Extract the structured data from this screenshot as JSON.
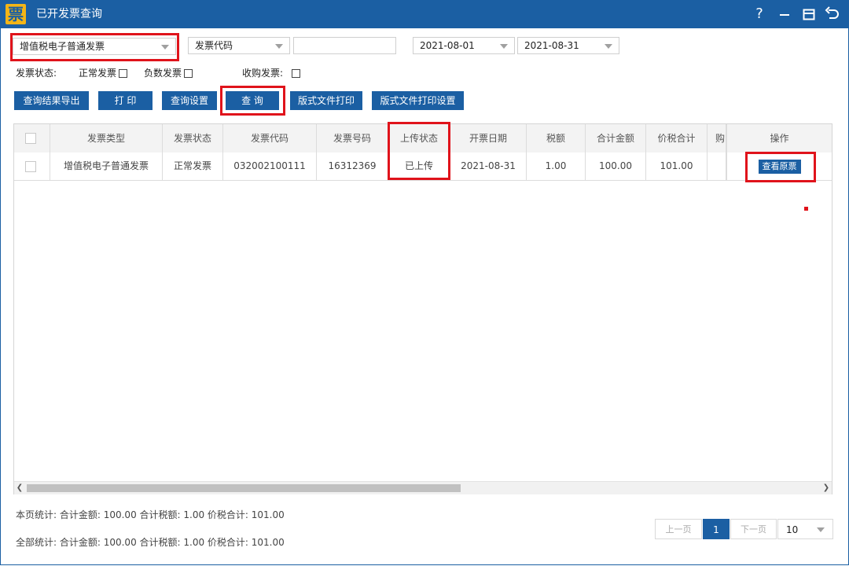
{
  "window": {
    "logo_glyph": "票",
    "title": "已开发票查询",
    "controls": [
      "help-icon",
      "minimize-icon",
      "restore-icon",
      "back-icon"
    ],
    "help_glyph": "?"
  },
  "filters": {
    "invoice_type": "增值税电子普通发票",
    "field": "发票代码",
    "field_value": "",
    "date_from": "2021-08-01",
    "date_to": "2021-08-31"
  },
  "status_filter": {
    "label": "发票状态:",
    "normal": "正常发票",
    "negative": "负数发票",
    "purchase": "收购发票:"
  },
  "toolbar": {
    "export": "查询结果导出",
    "print": "打 印",
    "settings": "查询设置",
    "query": "查 询",
    "layout_print": "版式文件打印",
    "layout_print_settings": "版式文件打印设置"
  },
  "table": {
    "columns": [
      "发票类型",
      "发票状态",
      "发票代码",
      "发票号码",
      "上传状态",
      "开票日期",
      "税额",
      "合计金额",
      "价税合计",
      "购",
      "操作"
    ],
    "rows": [
      {
        "type": "增值税电子普通发票",
        "status": "正常发票",
        "code": "032002100111",
        "number": "16312369",
        "upload": "已上传",
        "date": "2021-08-31",
        "tax": "1.00",
        "amount": "100.00",
        "total": "101.00",
        "buyer": "",
        "action": "查看原票"
      }
    ]
  },
  "summary": {
    "page": "本页统计:  合计金额:  100.00  合计税额:  1.00   价税合计:  101.00",
    "all": "全部统计:  合计金额:  100.00  合计税额:  1.00   价税合计:  101.00"
  },
  "pager": {
    "prev": "上一页",
    "current": "1",
    "next": "下一页",
    "page_size": "10"
  },
  "colors": {
    "primary": "#1b5fa3",
    "highlight": "#e0131b",
    "logo": "#f3b517"
  }
}
